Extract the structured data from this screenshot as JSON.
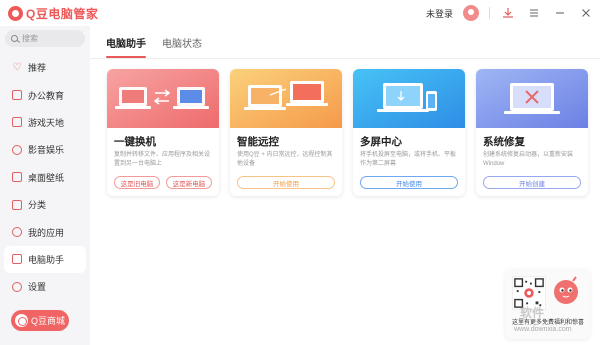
{
  "app": {
    "title": "Q豆电脑管家"
  },
  "header": {
    "login_label": "未登录"
  },
  "sidebar": {
    "search_placeholder": "搜索",
    "items": [
      {
        "label": "推荐",
        "icon": "heart-icon"
      },
      {
        "label": "办公教育",
        "icon": "briefcase-icon"
      },
      {
        "label": "游戏天地",
        "icon": "gamepad-icon"
      },
      {
        "label": "影音娱乐",
        "icon": "video-icon"
      },
      {
        "label": "桌面壁纸",
        "icon": "image-icon"
      },
      {
        "label": "分类",
        "icon": "grid-icon"
      },
      {
        "label": "我的应用",
        "icon": "user-icon"
      },
      {
        "label": "电脑助手",
        "icon": "monitor-icon"
      },
      {
        "label": "设置",
        "icon": "gear-icon"
      }
    ],
    "active_item": "电脑助手",
    "shop_label": "Q豆商城"
  },
  "tabs": [
    {
      "label": "电脑助手",
      "active": true
    },
    {
      "label": "电脑状态",
      "active": false
    }
  ],
  "cards": [
    {
      "title": "一键换机",
      "desc": "复制并转移文件、应用程序及相关设置到另一台电脑上",
      "buttons": [
        "这是旧电脑",
        "这是新电脑"
      ],
      "accent": "#f07b7b"
    },
    {
      "title": "智能远控",
      "desc": "使用Q豆 + 内日常远控，远程控制其他设备",
      "buttons": [
        "开始使用"
      ],
      "accent": "#f7a957"
    },
    {
      "title": "多屏中心",
      "desc": "将手机投屏至电脑，或将手机、平板作为第二屏幕",
      "buttons": [
        "开始使用"
      ],
      "accent": "#3fa4ee"
    },
    {
      "title": "系统修复",
      "desc": "创建系统修复启动器，以重新安装Window",
      "buttons": [
        "开始创建"
      ],
      "accent": "#7f94ea"
    }
  ],
  "qr": {
    "caption": "这里有更多免费福利和惊喜"
  },
  "watermark": {
    "big": "软件",
    "small": "www.downxia.com"
  }
}
